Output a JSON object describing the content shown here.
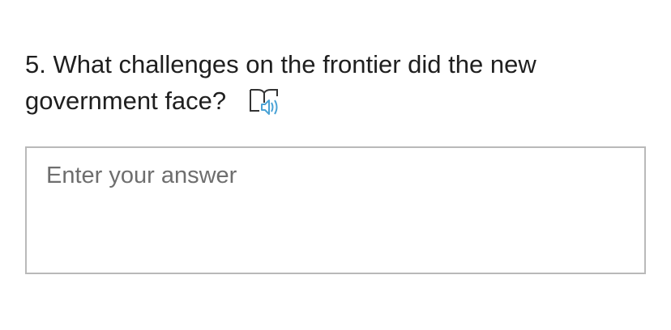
{
  "question": {
    "number": "5.",
    "text": "What challenges on the frontier did the new government face?"
  },
  "immersive_reader_icon": {
    "name": "immersive-reader-icon",
    "accent_color": "#4aa3d6"
  },
  "answer": {
    "placeholder": "Enter your answer",
    "value": ""
  }
}
